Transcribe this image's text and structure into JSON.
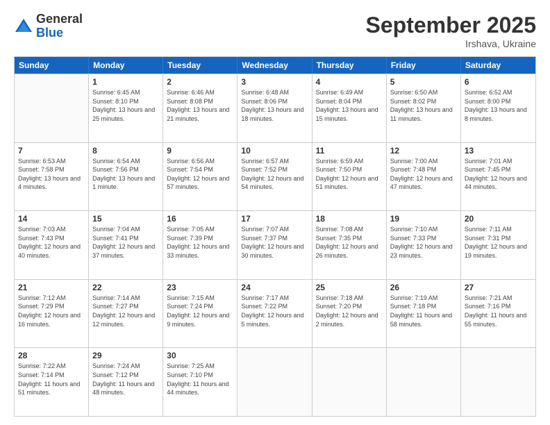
{
  "logo": {
    "general": "General",
    "blue": "Blue"
  },
  "header": {
    "month": "September 2025",
    "location": "Irshava, Ukraine"
  },
  "weekdays": [
    "Sunday",
    "Monday",
    "Tuesday",
    "Wednesday",
    "Thursday",
    "Friday",
    "Saturday"
  ],
  "rows": [
    [
      {
        "day": "",
        "sunrise": "",
        "sunset": "",
        "daylight": ""
      },
      {
        "day": "1",
        "sunrise": "Sunrise: 6:45 AM",
        "sunset": "Sunset: 8:10 PM",
        "daylight": "Daylight: 13 hours and 25 minutes."
      },
      {
        "day": "2",
        "sunrise": "Sunrise: 6:46 AM",
        "sunset": "Sunset: 8:08 PM",
        "daylight": "Daylight: 13 hours and 21 minutes."
      },
      {
        "day": "3",
        "sunrise": "Sunrise: 6:48 AM",
        "sunset": "Sunset: 8:06 PM",
        "daylight": "Daylight: 13 hours and 18 minutes."
      },
      {
        "day": "4",
        "sunrise": "Sunrise: 6:49 AM",
        "sunset": "Sunset: 8:04 PM",
        "daylight": "Daylight: 13 hours and 15 minutes."
      },
      {
        "day": "5",
        "sunrise": "Sunrise: 6:50 AM",
        "sunset": "Sunset: 8:02 PM",
        "daylight": "Daylight: 13 hours and 11 minutes."
      },
      {
        "day": "6",
        "sunrise": "Sunrise: 6:52 AM",
        "sunset": "Sunset: 8:00 PM",
        "daylight": "Daylight: 13 hours and 8 minutes."
      }
    ],
    [
      {
        "day": "7",
        "sunrise": "Sunrise: 6:53 AM",
        "sunset": "Sunset: 7:58 PM",
        "daylight": "Daylight: 13 hours and 4 minutes."
      },
      {
        "day": "8",
        "sunrise": "Sunrise: 6:54 AM",
        "sunset": "Sunset: 7:56 PM",
        "daylight": "Daylight: 13 hours and 1 minute."
      },
      {
        "day": "9",
        "sunrise": "Sunrise: 6:56 AM",
        "sunset": "Sunset: 7:54 PM",
        "daylight": "Daylight: 12 hours and 57 minutes."
      },
      {
        "day": "10",
        "sunrise": "Sunrise: 6:57 AM",
        "sunset": "Sunset: 7:52 PM",
        "daylight": "Daylight: 12 hours and 54 minutes."
      },
      {
        "day": "11",
        "sunrise": "Sunrise: 6:59 AM",
        "sunset": "Sunset: 7:50 PM",
        "daylight": "Daylight: 12 hours and 51 minutes."
      },
      {
        "day": "12",
        "sunrise": "Sunrise: 7:00 AM",
        "sunset": "Sunset: 7:48 PM",
        "daylight": "Daylight: 12 hours and 47 minutes."
      },
      {
        "day": "13",
        "sunrise": "Sunrise: 7:01 AM",
        "sunset": "Sunset: 7:45 PM",
        "daylight": "Daylight: 12 hours and 44 minutes."
      }
    ],
    [
      {
        "day": "14",
        "sunrise": "Sunrise: 7:03 AM",
        "sunset": "Sunset: 7:43 PM",
        "daylight": "Daylight: 12 hours and 40 minutes."
      },
      {
        "day": "15",
        "sunrise": "Sunrise: 7:04 AM",
        "sunset": "Sunset: 7:41 PM",
        "daylight": "Daylight: 12 hours and 37 minutes."
      },
      {
        "day": "16",
        "sunrise": "Sunrise: 7:05 AM",
        "sunset": "Sunset: 7:39 PM",
        "daylight": "Daylight: 12 hours and 33 minutes."
      },
      {
        "day": "17",
        "sunrise": "Sunrise: 7:07 AM",
        "sunset": "Sunset: 7:37 PM",
        "daylight": "Daylight: 12 hours and 30 minutes."
      },
      {
        "day": "18",
        "sunrise": "Sunrise: 7:08 AM",
        "sunset": "Sunset: 7:35 PM",
        "daylight": "Daylight: 12 hours and 26 minutes."
      },
      {
        "day": "19",
        "sunrise": "Sunrise: 7:10 AM",
        "sunset": "Sunset: 7:33 PM",
        "daylight": "Daylight: 12 hours and 23 minutes."
      },
      {
        "day": "20",
        "sunrise": "Sunrise: 7:11 AM",
        "sunset": "Sunset: 7:31 PM",
        "daylight": "Daylight: 12 hours and 19 minutes."
      }
    ],
    [
      {
        "day": "21",
        "sunrise": "Sunrise: 7:12 AM",
        "sunset": "Sunset: 7:29 PM",
        "daylight": "Daylight: 12 hours and 16 minutes."
      },
      {
        "day": "22",
        "sunrise": "Sunrise: 7:14 AM",
        "sunset": "Sunset: 7:27 PM",
        "daylight": "Daylight: 12 hours and 12 minutes."
      },
      {
        "day": "23",
        "sunrise": "Sunrise: 7:15 AM",
        "sunset": "Sunset: 7:24 PM",
        "daylight": "Daylight: 12 hours and 9 minutes."
      },
      {
        "day": "24",
        "sunrise": "Sunrise: 7:17 AM",
        "sunset": "Sunset: 7:22 PM",
        "daylight": "Daylight: 12 hours and 5 minutes."
      },
      {
        "day": "25",
        "sunrise": "Sunrise: 7:18 AM",
        "sunset": "Sunset: 7:20 PM",
        "daylight": "Daylight: 12 hours and 2 minutes."
      },
      {
        "day": "26",
        "sunrise": "Sunrise: 7:19 AM",
        "sunset": "Sunset: 7:18 PM",
        "daylight": "Daylight: 11 hours and 58 minutes."
      },
      {
        "day": "27",
        "sunrise": "Sunrise: 7:21 AM",
        "sunset": "Sunset: 7:16 PM",
        "daylight": "Daylight: 11 hours and 55 minutes."
      }
    ],
    [
      {
        "day": "28",
        "sunrise": "Sunrise: 7:22 AM",
        "sunset": "Sunset: 7:14 PM",
        "daylight": "Daylight: 11 hours and 51 minutes."
      },
      {
        "day": "29",
        "sunrise": "Sunrise: 7:24 AM",
        "sunset": "Sunset: 7:12 PM",
        "daylight": "Daylight: 11 hours and 48 minutes."
      },
      {
        "day": "30",
        "sunrise": "Sunrise: 7:25 AM",
        "sunset": "Sunset: 7:10 PM",
        "daylight": "Daylight: 11 hours and 44 minutes."
      },
      {
        "day": "",
        "sunrise": "",
        "sunset": "",
        "daylight": ""
      },
      {
        "day": "",
        "sunrise": "",
        "sunset": "",
        "daylight": ""
      },
      {
        "day": "",
        "sunrise": "",
        "sunset": "",
        "daylight": ""
      },
      {
        "day": "",
        "sunrise": "",
        "sunset": "",
        "daylight": ""
      }
    ]
  ]
}
